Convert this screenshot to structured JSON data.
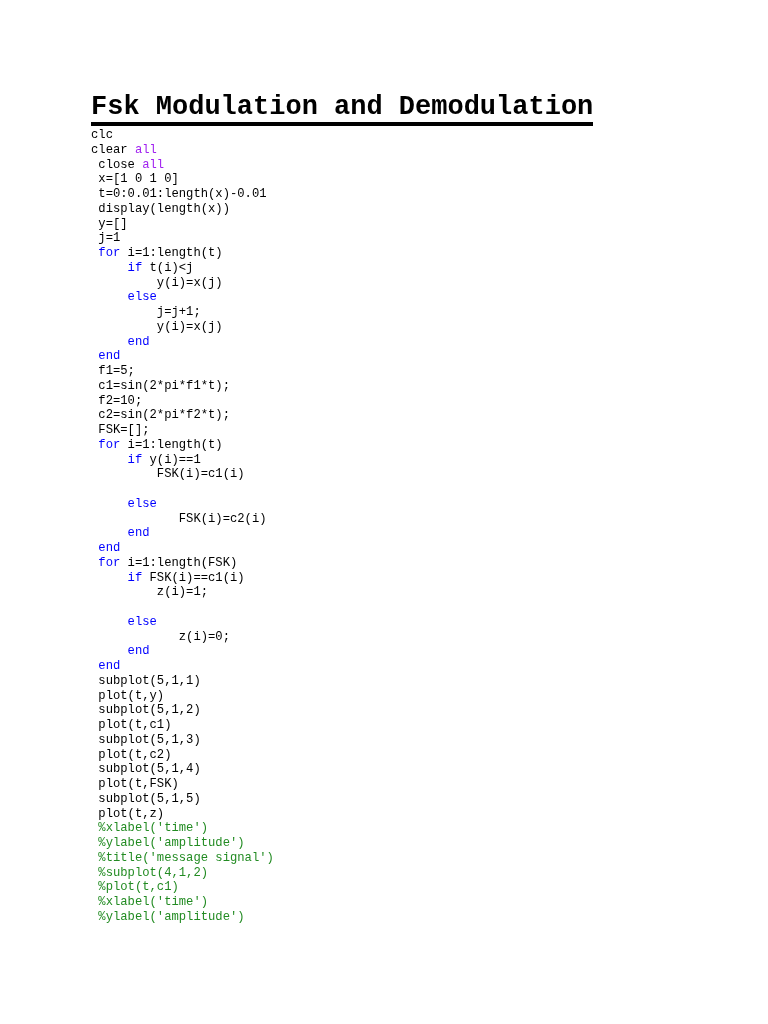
{
  "title": "Fsk Modulation and Demodulation",
  "lines": [
    {
      "kind": "code",
      "tokens": [
        {
          "kind": "plain",
          "text": "clc"
        }
      ]
    },
    {
      "kind": "code",
      "tokens": [
        {
          "kind": "plain",
          "text": "clear "
        },
        {
          "kind": "string",
          "text": "all"
        }
      ]
    },
    {
      "kind": "code",
      "tokens": [
        {
          "kind": "plain",
          "text": " close "
        },
        {
          "kind": "string",
          "text": "all"
        }
      ]
    },
    {
      "kind": "code",
      "tokens": [
        {
          "kind": "plain",
          "text": " x=[1 0 1 0]"
        }
      ]
    },
    {
      "kind": "code",
      "tokens": [
        {
          "kind": "plain",
          "text": " t=0:0.01:length(x)-0.01"
        }
      ]
    },
    {
      "kind": "code",
      "tokens": [
        {
          "kind": "plain",
          "text": " display(length(x))"
        }
      ]
    },
    {
      "kind": "code",
      "tokens": [
        {
          "kind": "plain",
          "text": " y=[]"
        }
      ]
    },
    {
      "kind": "code",
      "tokens": [
        {
          "kind": "plain",
          "text": " j=1"
        }
      ]
    },
    {
      "kind": "code",
      "tokens": [
        {
          "kind": "keyword",
          "text": " for"
        },
        {
          "kind": "plain",
          "text": " i=1:length(t)"
        }
      ]
    },
    {
      "kind": "code",
      "tokens": [
        {
          "kind": "keyword",
          "text": "     if"
        },
        {
          "kind": "plain",
          "text": " t(i)<j"
        }
      ]
    },
    {
      "kind": "code",
      "tokens": [
        {
          "kind": "plain",
          "text": "         y(i)=x(j)"
        }
      ]
    },
    {
      "kind": "code",
      "tokens": [
        {
          "kind": "keyword",
          "text": "     else"
        }
      ]
    },
    {
      "kind": "code",
      "tokens": [
        {
          "kind": "plain",
          "text": "         j=j+1;"
        }
      ]
    },
    {
      "kind": "code",
      "tokens": [
        {
          "kind": "plain",
          "text": "         y(i)=x(j)"
        }
      ]
    },
    {
      "kind": "code",
      "tokens": [
        {
          "kind": "keyword",
          "text": "     end"
        }
      ]
    },
    {
      "kind": "code",
      "tokens": [
        {
          "kind": "keyword",
          "text": " end"
        }
      ]
    },
    {
      "kind": "code",
      "tokens": [
        {
          "kind": "plain",
          "text": " f1=5;"
        }
      ]
    },
    {
      "kind": "code",
      "tokens": [
        {
          "kind": "plain",
          "text": " c1=sin(2*pi*f1*t);"
        }
      ]
    },
    {
      "kind": "code",
      "tokens": [
        {
          "kind": "plain",
          "text": " f2=10;"
        }
      ]
    },
    {
      "kind": "code",
      "tokens": [
        {
          "kind": "plain",
          "text": " c2=sin(2*pi*f2*t);"
        }
      ]
    },
    {
      "kind": "code",
      "tokens": [
        {
          "kind": "plain",
          "text": " FSK=[];"
        }
      ]
    },
    {
      "kind": "code",
      "tokens": [
        {
          "kind": "keyword",
          "text": " for"
        },
        {
          "kind": "plain",
          "text": " i=1:length(t)"
        }
      ]
    },
    {
      "kind": "code",
      "tokens": [
        {
          "kind": "keyword",
          "text": "     if"
        },
        {
          "kind": "plain",
          "text": " y(i)==1"
        }
      ]
    },
    {
      "kind": "code",
      "tokens": [
        {
          "kind": "plain",
          "text": "         FSK(i)=c1(i)"
        }
      ]
    },
    {
      "kind": "blank"
    },
    {
      "kind": "code",
      "tokens": [
        {
          "kind": "keyword",
          "text": "     else"
        }
      ]
    },
    {
      "kind": "code",
      "tokens": [
        {
          "kind": "plain",
          "text": "            FSK(i)=c2(i)"
        }
      ]
    },
    {
      "kind": "code",
      "tokens": [
        {
          "kind": "keyword",
          "text": "     end"
        }
      ]
    },
    {
      "kind": "code",
      "tokens": [
        {
          "kind": "keyword",
          "text": " end"
        }
      ]
    },
    {
      "kind": "code",
      "tokens": [
        {
          "kind": "keyword",
          "text": " for"
        },
        {
          "kind": "plain",
          "text": " i=1:length(FSK)"
        }
      ]
    },
    {
      "kind": "code",
      "tokens": [
        {
          "kind": "keyword",
          "text": "     if"
        },
        {
          "kind": "plain",
          "text": " FSK(i)==c1(i)"
        }
      ]
    },
    {
      "kind": "code",
      "tokens": [
        {
          "kind": "plain",
          "text": "         z(i)=1;"
        }
      ]
    },
    {
      "kind": "blank"
    },
    {
      "kind": "code",
      "tokens": [
        {
          "kind": "keyword",
          "text": "     else"
        }
      ]
    },
    {
      "kind": "code",
      "tokens": [
        {
          "kind": "plain",
          "text": "            z(i)=0;"
        }
      ]
    },
    {
      "kind": "code",
      "tokens": [
        {
          "kind": "keyword",
          "text": "     end"
        }
      ]
    },
    {
      "kind": "code",
      "tokens": [
        {
          "kind": "keyword",
          "text": " end"
        }
      ]
    },
    {
      "kind": "code",
      "tokens": [
        {
          "kind": "plain",
          "text": " subplot(5,1,1)"
        }
      ]
    },
    {
      "kind": "code",
      "tokens": [
        {
          "kind": "plain",
          "text": " plot(t,y)"
        }
      ]
    },
    {
      "kind": "code",
      "tokens": [
        {
          "kind": "plain",
          "text": " subplot(5,1,2)"
        }
      ]
    },
    {
      "kind": "code",
      "tokens": [
        {
          "kind": "plain",
          "text": " plot(t,c1)"
        }
      ]
    },
    {
      "kind": "code",
      "tokens": [
        {
          "kind": "plain",
          "text": " subplot(5,1,3)"
        }
      ]
    },
    {
      "kind": "code",
      "tokens": [
        {
          "kind": "plain",
          "text": " plot(t,c2)"
        }
      ]
    },
    {
      "kind": "code",
      "tokens": [
        {
          "kind": "plain",
          "text": " subplot(5,1,4)"
        }
      ]
    },
    {
      "kind": "code",
      "tokens": [
        {
          "kind": "plain",
          "text": " plot(t,FSK)"
        }
      ]
    },
    {
      "kind": "code",
      "tokens": [
        {
          "kind": "plain",
          "text": " subplot(5,1,5)"
        }
      ]
    },
    {
      "kind": "code",
      "tokens": [
        {
          "kind": "plain",
          "text": " plot(t,z)"
        }
      ]
    },
    {
      "kind": "code",
      "tokens": [
        {
          "kind": "comment",
          "text": " %xlabel('time')"
        }
      ]
    },
    {
      "kind": "code",
      "tokens": [
        {
          "kind": "comment",
          "text": " %ylabel('amplitude')"
        }
      ]
    },
    {
      "kind": "code",
      "tokens": [
        {
          "kind": "comment",
          "text": " %title('message signal')"
        }
      ]
    },
    {
      "kind": "code",
      "tokens": [
        {
          "kind": "comment",
          "text": " %subplot(4,1,2)"
        }
      ]
    },
    {
      "kind": "code",
      "tokens": [
        {
          "kind": "comment",
          "text": " %plot(t,c1)"
        }
      ]
    },
    {
      "kind": "code",
      "tokens": [
        {
          "kind": "comment",
          "text": " %xlabel('time')"
        }
      ]
    },
    {
      "kind": "code",
      "tokens": [
        {
          "kind": "comment",
          "text": " %ylabel('amplitude')"
        }
      ]
    }
  ]
}
